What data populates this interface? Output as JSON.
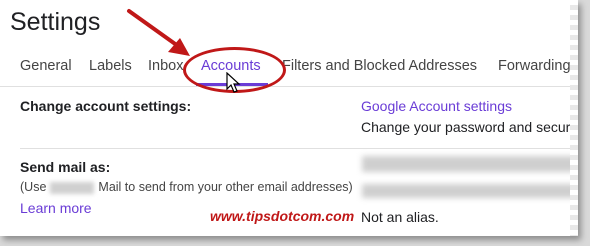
{
  "title": "Settings",
  "tabs": [
    {
      "label": "General"
    },
    {
      "label": "Labels"
    },
    {
      "label": "Inbox"
    },
    {
      "label": "Accounts"
    },
    {
      "label": "Filters and Blocked Addresses"
    },
    {
      "label": "Forwarding"
    }
  ],
  "active_tab": "Accounts",
  "change_account": {
    "label": "Change account settings:",
    "link": "Google Account settings",
    "description": "Change your password and secur"
  },
  "send_mail": {
    "label": "Send mail as:",
    "use_prefix": "(Use",
    "use_suffix": "Mail to send from your other email addresses)",
    "learn_more": "Learn more",
    "status": "Not an alias."
  },
  "watermark": "www.tipsdotcom.com",
  "colors": {
    "accent": "#6a3cd6",
    "annotation": "#c01818"
  },
  "icons": [
    "annotation-arrow-icon",
    "mouse-cursor-icon"
  ]
}
